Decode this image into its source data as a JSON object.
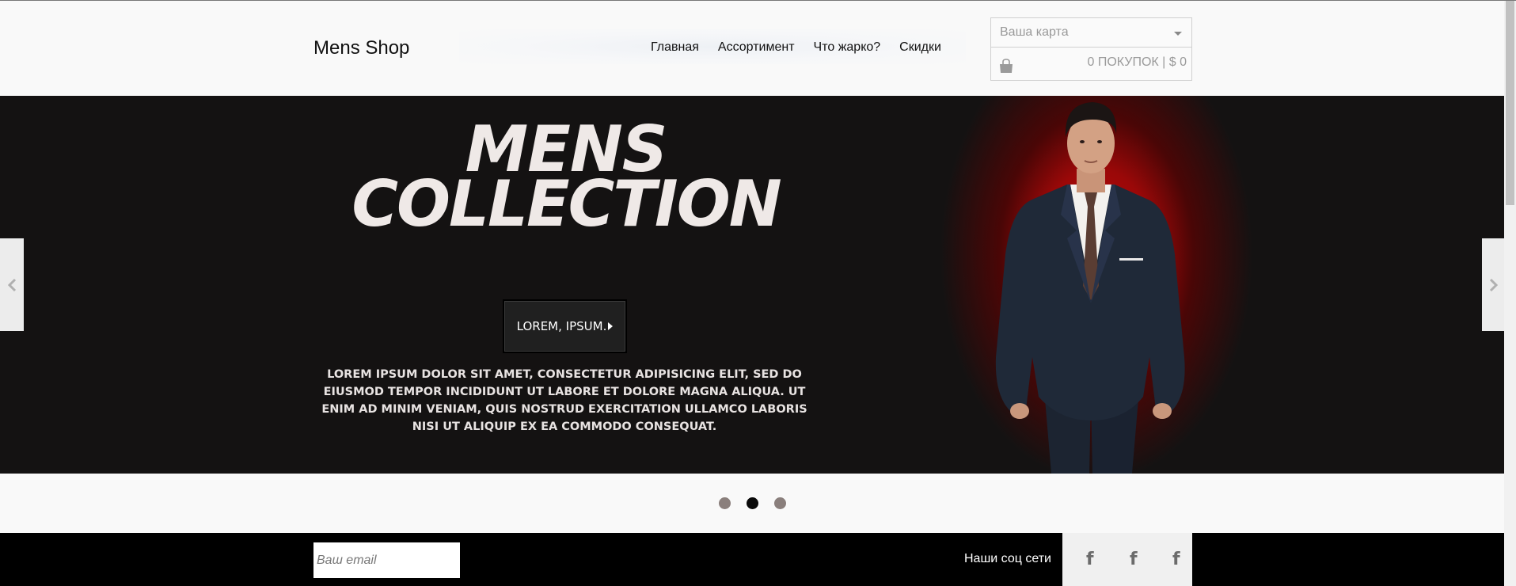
{
  "header": {
    "logo": "Mens Shop",
    "nav": [
      "Главная",
      "Ассортимент",
      "Что жарко?",
      "Скидки"
    ],
    "cart": {
      "select_placeholder": "Ваша карта",
      "summary": "0 ПОКУПОК | $ 0"
    }
  },
  "hero": {
    "title_line1": "MENS",
    "title_line2": "COLLECTION",
    "button_label": "LOREM, IPSUM.",
    "description": "LOREM IPSUM DOLOR SIT AMET, CONSECTETUR ADIPISICING ELIT, SED DO EIUSMOD TEMPOR INCIDIDUNT UT LABORE ET DOLORE MAGNA ALIQUA. UT ENIM AD MINIM VENIAM, QUIS NOSTRUD EXERCITATION ULLAMCO LABORIS NISI UT ALIQUIP EX EA COMMODO CONSEQUAT.",
    "glow_color": "#c80b0b"
  },
  "carousel": {
    "slides": 3,
    "active_index": 1,
    "prev_icon": "chevron-left-icon",
    "next_icon": "chevron-right-icon"
  },
  "footer": {
    "email_placeholder": "Ваш email",
    "social_label": "Наши соц сети",
    "social_icons": [
      "f",
      "f",
      "f"
    ]
  }
}
